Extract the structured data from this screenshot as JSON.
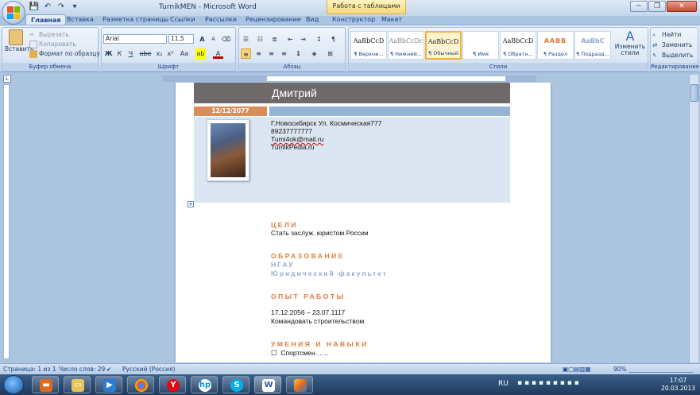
{
  "title_bar": {
    "app_title": "TurnikMEN - Microsoft Word",
    "context_header": "Работа с таблицами",
    "qat_icons": [
      "save-icon",
      "undo-icon",
      "redo-icon",
      "customize-icon"
    ]
  },
  "tabs": [
    "Главная",
    "Вставка",
    "Разметка страницы",
    "Ссылки",
    "Рассылки",
    "Рецензирование",
    "Вид",
    "Конструктор",
    "Макет"
  ],
  "ribbon": {
    "clipboard": {
      "paste": "Вставить",
      "cut": "Вырезать",
      "copy": "Копировать",
      "format_painter": "Формат по образцу",
      "label": "Буфер обмена"
    },
    "font": {
      "name": "Arial",
      "size": "11,5",
      "label": "Шрифт",
      "bold": "Ж",
      "italic": "К",
      "underline": "Ч",
      "strike": "abe",
      "sub": "x₂",
      "sup": "x²",
      "case": "Aa",
      "grow": "A",
      "shrink": "A"
    },
    "paragraph": {
      "label": "Абзац"
    },
    "styles": {
      "label": "Стили",
      "items": [
        {
          "sample": "AaBbCcD",
          "name": "¶ Верхни..."
        },
        {
          "sample": "AaBbCcDc",
          "name": "¶ Нижний..."
        },
        {
          "sample": "AaBbCcD",
          "name": "¶ Обычный"
        },
        {
          "sample": "",
          "name": "¶ Имя"
        },
        {
          "sample": "AaBbCcD",
          "name": "¶ Обратн..."
        },
        {
          "sample": "AABB",
          "name": "¶ Раздел"
        },
        {
          "sample": "AaBbC",
          "name": "¶ Подразд..."
        }
      ],
      "change": "Изменить стили"
    },
    "editing": {
      "find": "Найти",
      "replace": "Заменить",
      "select": "Выделить",
      "label": "Редактирование"
    }
  },
  "document": {
    "name": "Дмитрий",
    "date": "12/12/2077",
    "contact": [
      "Г.Новосибирск Ул. Космическая777",
      "89237777777",
      "Tumi4ok@mail.ru",
      "TumikPedia.ru"
    ],
    "sections": {
      "goals_title": "ЦЕЛИ",
      "goals_text": "Стать заслуж. юристом России",
      "edu_title": "ОБРАЗОВАНИЕ",
      "edu_school": "НГАУ",
      "edu_faculty": "Юридический факультет",
      "exp_title": "ОПЫТ РАБОТЫ",
      "exp_dates": "17.12.2056 – 23.07.1117",
      "exp_text": "Командовать  строительством",
      "skills_title": "УМЕНИЯ И НАВЫКИ",
      "skills_item": "Спортсмен……"
    }
  },
  "status_bar": {
    "page": "Страница: 1 из 1",
    "words": "Число слов: 29",
    "language": "Русский (Россия)",
    "zoom": "90%"
  },
  "taskbar": {
    "apps": [
      "explorer",
      "media",
      "yandex",
      "chrome",
      "hp",
      "skype",
      "word",
      "paint"
    ],
    "tray_lang": "RU",
    "time": "17:07",
    "date": "20.03.2013"
  },
  "colors": {
    "accent_orange": "#e07b39",
    "name_bar": "#6d6a69",
    "info_bg": "#dce6f2",
    "date_bar": "#d98e5a"
  }
}
